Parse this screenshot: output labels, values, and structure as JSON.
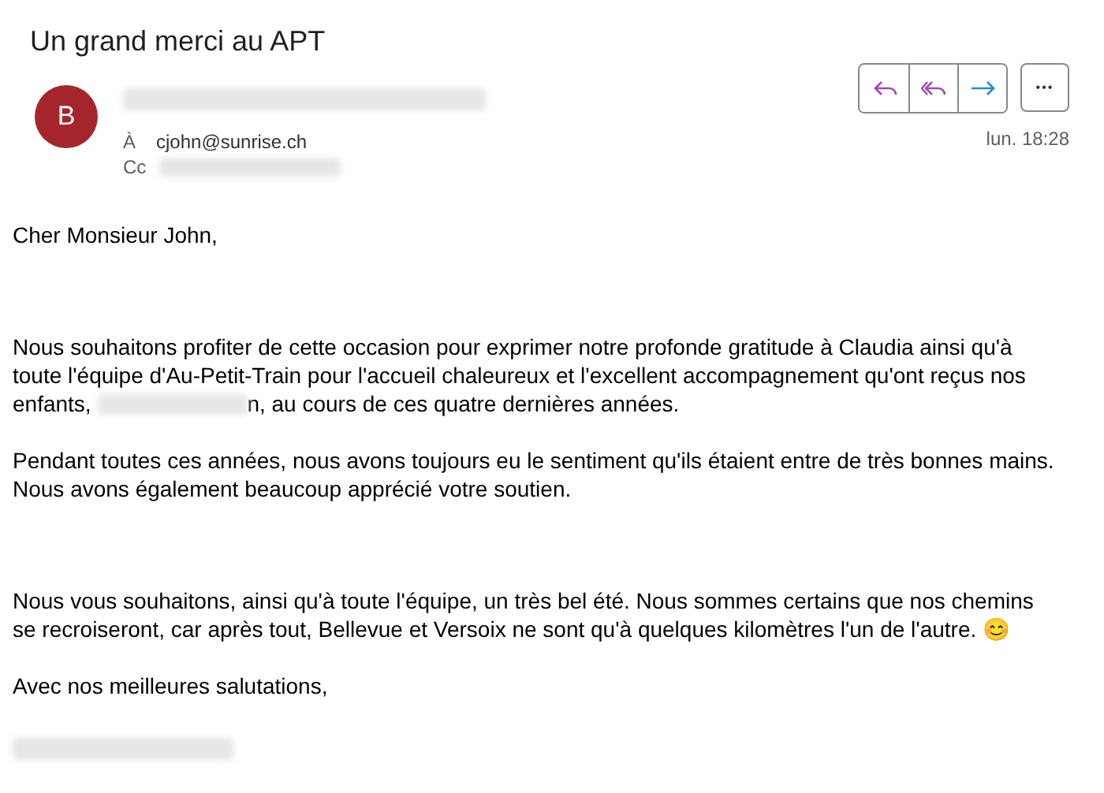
{
  "subject": "Un grand merci au APT",
  "sender": {
    "initial": "B",
    "color": "#a4262c",
    "name_redacted": true
  },
  "recipients": [
    {
      "label": "À",
      "value": "cjohn@sunrise.ch",
      "redacted": false
    },
    {
      "label": "Cc",
      "redacted": true
    }
  ],
  "actions": [
    {
      "kind": "reply"
    },
    {
      "kind": "reply-all"
    },
    {
      "kind": "forward"
    }
  ],
  "more": "•••",
  "date": "lun. 18:28",
  "body": [
    {
      "parts": [
        {
          "text": "Cher Monsieur John,"
        }
      ]
    },
    {
      "parts": [
        {
          "text": "Nous souhaitons profiter de cette occasion pour exprimer notre profonde gratitude à Claudia ainsi qu'à toute l'équipe d'Au-Petit-Train pour l'accueil chaleureux et l'excellent accompagnement qu'ont reçus nos enfants, "
        },
        {
          "kind": "redacted"
        },
        {
          "text": "n, au cours de ces quatre dernières années."
        }
      ]
    },
    {
      "parts": [
        {
          "text": "Pendant toutes ces années, nous avons toujours eu le sentiment qu'ils étaient entre de très bonnes mains."
        },
        {
          "kind": "break"
        },
        {
          "text": "Nous avons également beaucoup apprécié votre soutien."
        }
      ]
    },
    {
      "parts": [
        {
          "text": "Nous vous souhaitons, ainsi qu'à toute l'équipe, un très bel été. Nous sommes certains que nos chemins se recroiseront, car après tout, Bellevue et Versoix ne sont qu'à quelques kilomètres l'un de l'autre. 😊"
        }
      ]
    },
    {
      "parts": [
        {
          "text": "Avec nos meilleures salutations,"
        }
      ]
    }
  ],
  "signature_redacted": true
}
